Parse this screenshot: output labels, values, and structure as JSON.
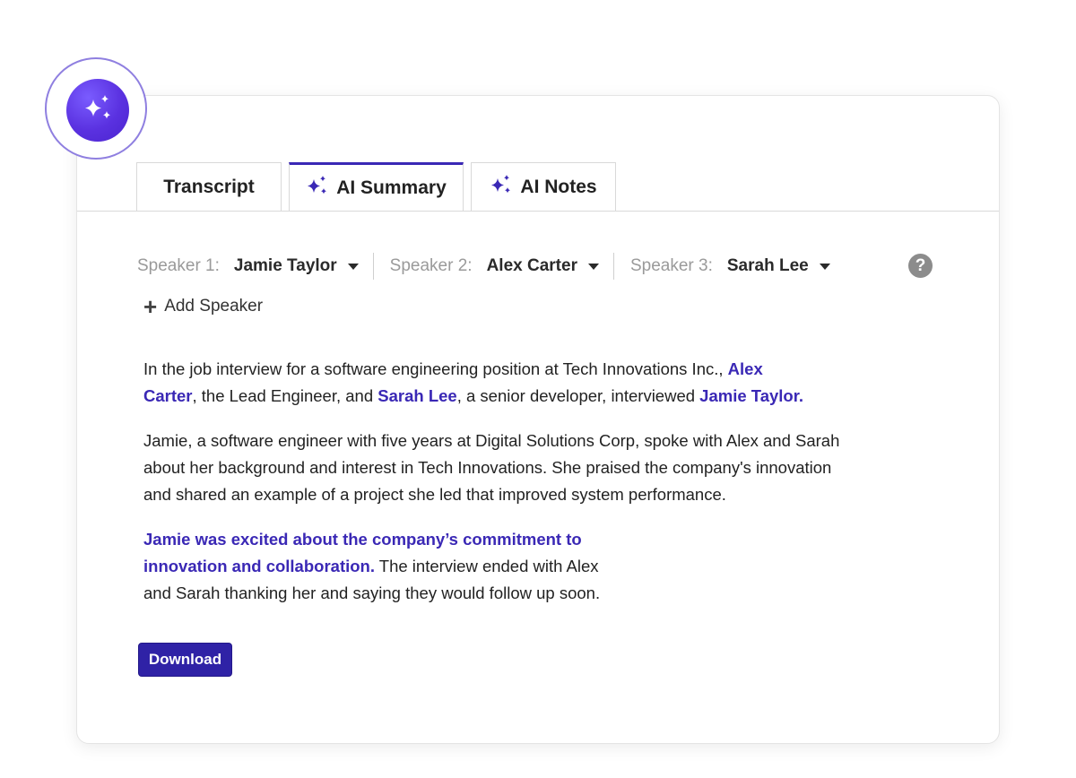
{
  "tabs": [
    {
      "label": "Transcript",
      "active": false,
      "icon": null
    },
    {
      "label": "AI Summary",
      "active": true,
      "icon": "sparkle-icon"
    },
    {
      "label": "AI Notes",
      "active": false,
      "icon": "sparkle-icon"
    }
  ],
  "speakers": [
    {
      "label": "Speaker 1:",
      "name": "Jamie Taylor"
    },
    {
      "label": "Speaker 2:",
      "name": "Alex Carter"
    },
    {
      "label": "Speaker 3:",
      "name": "Sarah Lee"
    }
  ],
  "help_icon": "?",
  "add_speaker_label": "Add Speaker",
  "summary": {
    "p1": {
      "t1": "In the job interview for a software engineering position at Tech Innovations Inc., ",
      "h1": "Alex",
      "h1b": "Carter",
      "t2": ", the Lead Engineer, and ",
      "h2": "Sarah Lee",
      "t3": ", a senior developer, interviewed ",
      "h3": "Jamie Taylor",
      "t4": "."
    },
    "p2": {
      "l1": "Jamie, a software engineer with five years at Digital Solutions Corp, spoke with Alex and Sarah",
      "l2": "about her background and interest in Tech Innovations. She praised the company's innovation",
      "l3": "and shared an example of a project she led that improved system performance."
    },
    "p3": {
      "h1": "Jamie was excited about the company’s commitment to",
      "h2": "innovation and collaboration.",
      "t1": " The interview ended with Alex",
      "t2": "and Sarah thanking her and saying they would follow up soon."
    }
  },
  "download_label": "Download",
  "colors": {
    "accent": "#3a28b5",
    "button": "#2f22a6",
    "badge": "#5a31e0"
  }
}
